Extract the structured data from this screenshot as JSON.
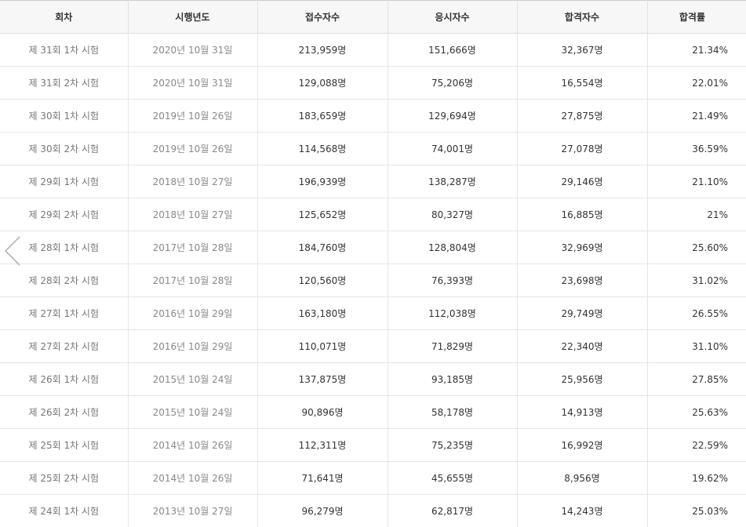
{
  "table": {
    "headers": [
      "회차",
      "시행년도",
      "접수자수",
      "응시자수",
      "합격자수",
      "합격률"
    ],
    "rows": [
      [
        "제 31회 1차 시험",
        "2020년 10월 31일",
        "213,959명",
        "151,666명",
        "32,367명",
        "21.34%"
      ],
      [
        "제 31회 2차 시험",
        "2020년 10월 31일",
        "129,088명",
        "75,206명",
        "16,554명",
        "22.01%"
      ],
      [
        "제 30회 1차 시험",
        "2019년 10월 26일",
        "183,659명",
        "129,694명",
        "27,875명",
        "21.49%"
      ],
      [
        "제 30회 2차 시험",
        "2019년 10월 26일",
        "114,568명",
        "74,001명",
        "27,078명",
        "36.59%"
      ],
      [
        "제 29회 1차 시험",
        "2018년 10월 27일",
        "196,939명",
        "138,287명",
        "29,146명",
        "21.10%"
      ],
      [
        "제 29회 2차 시험",
        "2018년 10월 27일",
        "125,652명",
        "80,327명",
        "16,885명",
        "21%"
      ],
      [
        "제 28회 1차 시험",
        "2017년 10월 28일",
        "184,760명",
        "128,804명",
        "32,969명",
        "25.60%"
      ],
      [
        "제 28회 2차 시험",
        "2017년 10월 28일",
        "120,560명",
        "76,393명",
        "23,698명",
        "31.02%"
      ],
      [
        "제 27회 1차 시험",
        "2016년 10월 29일",
        "163,180명",
        "112,038명",
        "29,749명",
        "26.55%"
      ],
      [
        "제 27회 2차 시험",
        "2016년 10월 29일",
        "110,071명",
        "71,829명",
        "22,340명",
        "31.10%"
      ],
      [
        "제 26회 1차 시험",
        "2015년 10월 24일",
        "137,875명",
        "93,185명",
        "25,956명",
        "27.85%"
      ],
      [
        "제 26회 2차 시험",
        "2015년 10월 24일",
        "90,896명",
        "58,178명",
        "14,913명",
        "25.63%"
      ],
      [
        "제 25회 1차 시험",
        "2014년 10월 26일",
        "112,311명",
        "75,235명",
        "16,992명",
        "22.59%"
      ],
      [
        "제 25회 2차 시험",
        "2014년 10월 26일",
        "71,641명",
        "45,655명",
        "8,956명",
        "19.62%"
      ],
      [
        "제 24회 1차 시험",
        "2013년 10월 27일",
        "96,279명",
        "62,817명",
        "14,243명",
        "25.03%"
      ]
    ]
  },
  "navigation": {
    "prev_icon": "chevron-left-icon",
    "icon_color": "#b5b5b5"
  }
}
